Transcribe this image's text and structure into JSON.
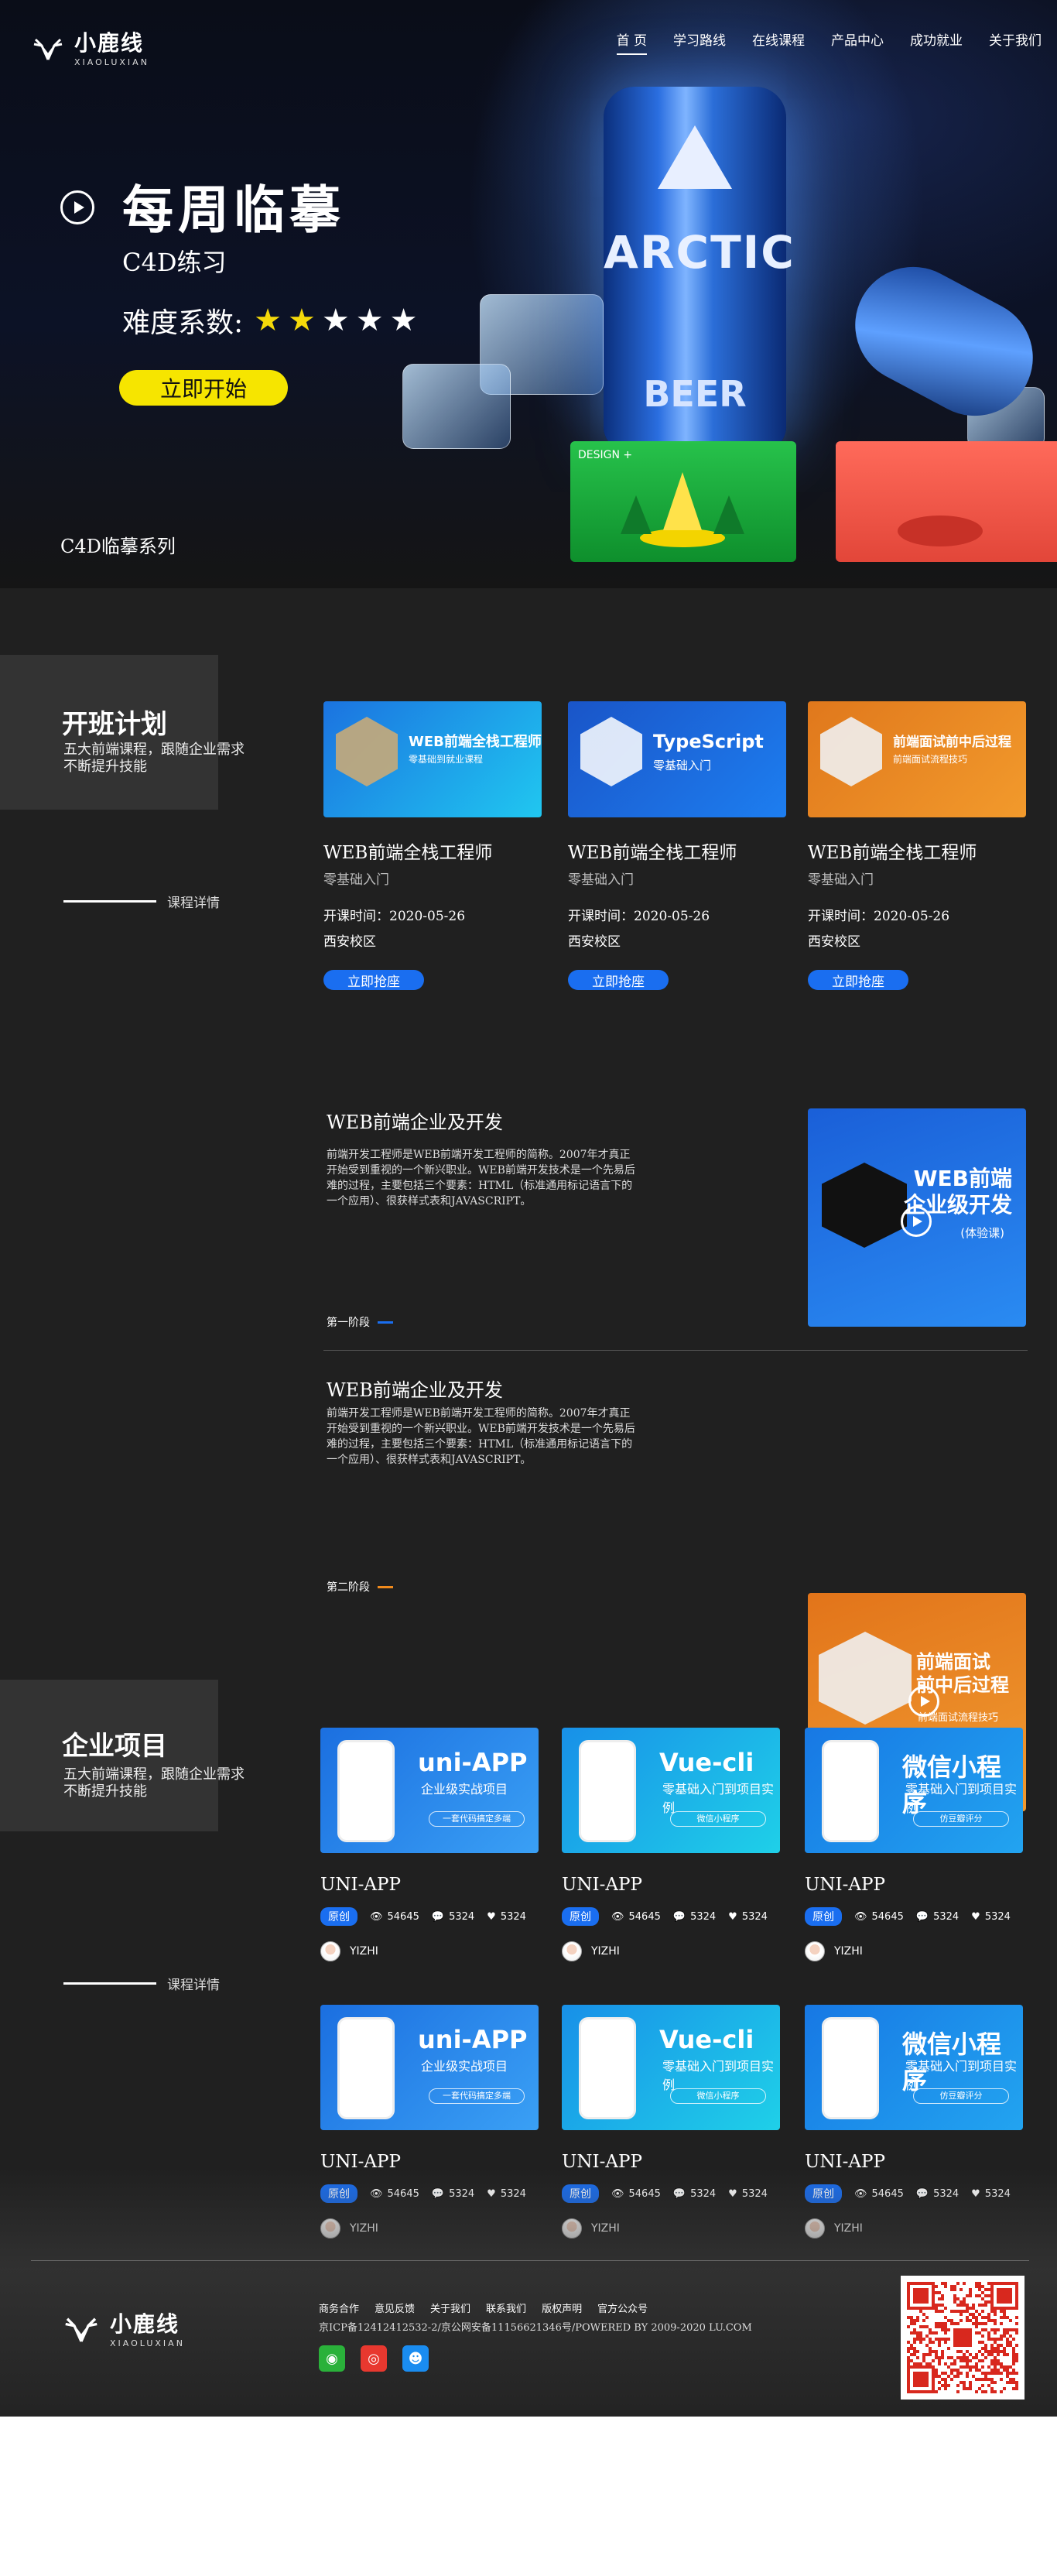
{
  "brand": {
    "name": "小鹿线",
    "en": "XIAOLUXIAN"
  },
  "nav": [
    "首 页",
    "学习路线",
    "在线课程",
    "产品中心",
    "成功就业",
    "关于我们"
  ],
  "hero": {
    "title": "每周临摹",
    "subtitle": "C4D练习",
    "difficulty_label": "难度系数:",
    "difficulty": 2,
    "difficulty_max": 5,
    "cta": "立即开始",
    "series": "C4D临摹系列",
    "can_brand": "ARCTIC",
    "can_sub": "BEER",
    "thumb_tag": "DESIGN +"
  },
  "plan": {
    "title": "开班计划",
    "desc": "五大前端课程，跟随企业需求不断提升技能",
    "detail": "课程详情",
    "courses": [
      {
        "img_title": "WEB前端全栈工程师",
        "img_sub": "零基础到就业课程",
        "name": "WEB前端全栈工程师",
        "sub": "零基础入门",
        "time": "开课时间：2020-05-26",
        "campus": "西安校区",
        "cta": "立即抢座"
      },
      {
        "img_title": "TypeScript",
        "img_sub": "零基础入门",
        "name": "WEB前端全栈工程师",
        "sub": "零基础入门",
        "time": "开课时间：2020-05-26",
        "campus": "西安校区",
        "cta": "立即抢座"
      },
      {
        "img_title": "前端面试前中后过程",
        "img_sub": "前端面试流程技巧",
        "name": "WEB前端全栈工程师",
        "sub": "零基础入门",
        "time": "开课时间：2020-05-26",
        "campus": "西安校区",
        "cta": "立即抢座"
      }
    ],
    "stages": [
      {
        "title": "WEB前端企业及开发",
        "text": "前端开发工程师是WEB前端开发工程师的简称。2007年才真正开始受到重视的一个新兴职业。WEB前端开发技术是一个先易后难的过程，主要包括三个要素：HTML（标准通用标记语言下的一个应用）、很获样式表和JAVASCRIPT。",
        "label": "第一阶段",
        "img_text": "WEB前端\n企业级开发",
        "img_sub": "(体验课)"
      },
      {
        "title": "WEB前端企业及开发",
        "text": "前端开发工程师是WEB前端开发工程师的简称。2007年才真正开始受到重视的一个新兴职业。WEB前端开发技术是一个先易后难的过程，主要包括三个要素：HTML（标准通用标记语言下的一个应用）、很获样式表和JAVASCRIPT。",
        "label": "第二阶段",
        "img_text": "前端面试\n前中后过程",
        "img_sub": "前端面试流程技巧"
      }
    ]
  },
  "projects": {
    "title": "企业项目",
    "desc": "五大前端课程，跟随企业需求不断提升技能",
    "detail": "课程详情",
    "items": [
      {
        "img_title": "uni-APP",
        "img_sub": "企业级实战项目",
        "img_bar": "一套代码搞定多端",
        "name": "UNI-APP",
        "badge": "原创",
        "views": "54645",
        "comments": "5324",
        "likes": "5324",
        "author": "YIZHI"
      },
      {
        "img_title": "Vue-cli",
        "img_sub": "零基础入门到项目实例",
        "img_bar": "微信小程序",
        "name": "UNI-APP",
        "badge": "原创",
        "views": "54645",
        "comments": "5324",
        "likes": "5324",
        "author": "YIZHI"
      },
      {
        "img_title": "微信小程序",
        "img_sub": "零基础入门到项目实例",
        "img_bar": "仿豆瓣评分",
        "name": "UNI-APP",
        "badge": "原创",
        "views": "54645",
        "comments": "5324",
        "likes": "5324",
        "author": "YIZHI"
      },
      {
        "img_title": "uni-APP",
        "img_sub": "企业级实战项目",
        "img_bar": "一套代码搞定多端",
        "name": "UNI-APP",
        "badge": "原创",
        "views": "54645",
        "comments": "5324",
        "likes": "5324",
        "author": "YIZHI"
      },
      {
        "img_title": "Vue-cli",
        "img_sub": "零基础入门到项目实例",
        "img_bar": "微信小程序",
        "name": "UNI-APP",
        "badge": "原创",
        "views": "54645",
        "comments": "5324",
        "likes": "5324",
        "author": "YIZHI"
      },
      {
        "img_title": "微信小程序",
        "img_sub": "零基础入门到项目实例",
        "img_bar": "仿豆瓣评分",
        "name": "UNI-APP",
        "badge": "原创",
        "views": "54645",
        "comments": "5324",
        "likes": "5324",
        "author": "YIZHI"
      }
    ]
  },
  "footer": {
    "links": [
      "商务合作",
      "意见反馈",
      "关于我们",
      "联系我们",
      "版权声明",
      "官方公众号"
    ],
    "icp": "京ICP备12412412532-2/京公网安备11156621346号/POWERED BY 2009-2020 LU.COM",
    "social": [
      "wechat",
      "weibo",
      "qq"
    ]
  },
  "colors": {
    "accent": "#1a6ef0",
    "yellow": "#f6e500",
    "bg": "#202020"
  }
}
